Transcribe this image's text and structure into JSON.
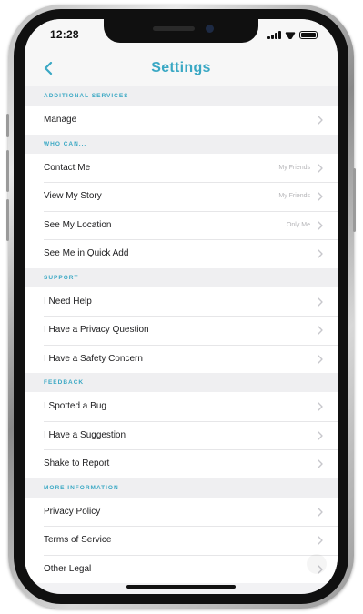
{
  "status_bar": {
    "time": "12:28"
  },
  "header": {
    "title": "Settings",
    "back_icon": "chevron-left-icon"
  },
  "colors": {
    "accent": "#3aa8c4",
    "row_text": "#1c1c1e",
    "value_text": "#b5b5b8",
    "section_bg": "#efeff1"
  },
  "sections": [
    {
      "header": "ADDITIONAL SERVICES",
      "items": [
        {
          "label": "Manage",
          "value": ""
        }
      ]
    },
    {
      "header": "WHO CAN...",
      "items": [
        {
          "label": "Contact Me",
          "value": "My Friends"
        },
        {
          "label": "View My Story",
          "value": "My Friends"
        },
        {
          "label": "See My Location",
          "value": "Only Me"
        },
        {
          "label": "See Me in Quick Add",
          "value": ""
        }
      ]
    },
    {
      "header": "SUPPORT",
      "items": [
        {
          "label": "I Need Help",
          "value": ""
        },
        {
          "label": "I Have a Privacy Question",
          "value": ""
        },
        {
          "label": "I Have a Safety Concern",
          "value": ""
        }
      ]
    },
    {
      "header": "FEEDBACK",
      "items": [
        {
          "label": "I Spotted a Bug",
          "value": ""
        },
        {
          "label": "I Have a Suggestion",
          "value": ""
        },
        {
          "label": "Shake to Report",
          "value": ""
        }
      ]
    },
    {
      "header": "MORE INFORMATION",
      "items": [
        {
          "label": "Privacy Policy",
          "value": ""
        },
        {
          "label": "Terms of Service",
          "value": ""
        },
        {
          "label": "Other Legal",
          "value": ""
        }
      ]
    }
  ]
}
